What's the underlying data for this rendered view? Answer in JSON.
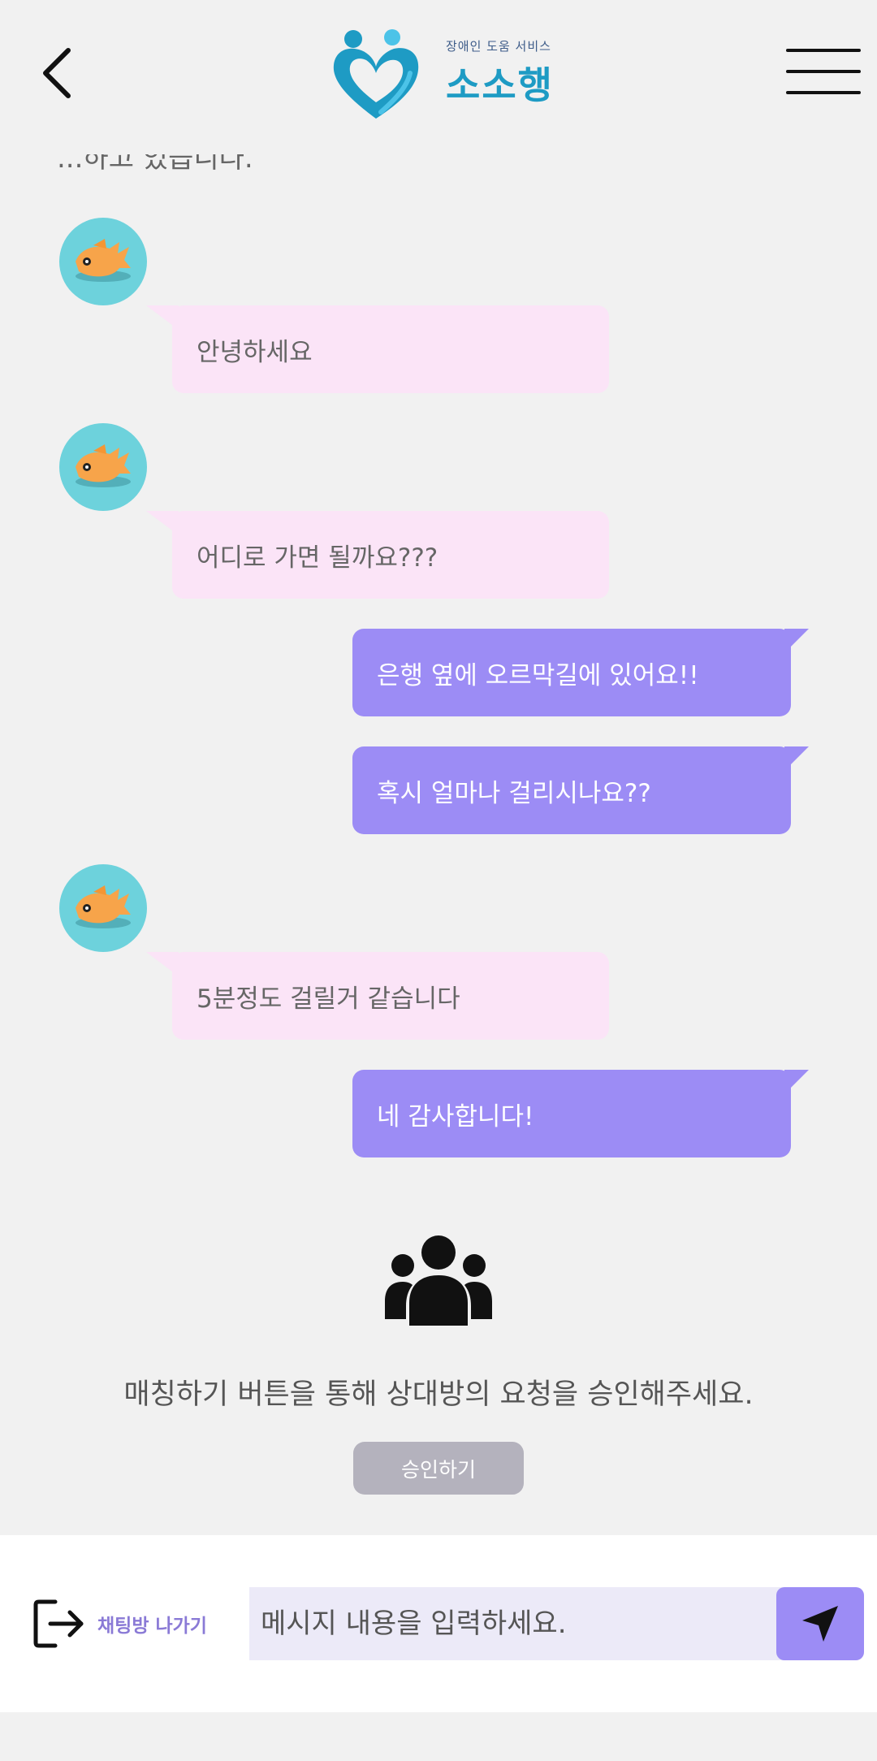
{
  "header": {
    "logo_sub": "장애인 도움 서비스",
    "logo_main": "소소행"
  },
  "chat": {
    "cut_text": "...하고 있습니다.",
    "messages": [
      {
        "side": "in",
        "text": "안녕하세요"
      },
      {
        "side": "in",
        "text": "어디로 가면 될까요???"
      },
      {
        "side": "out",
        "text": "은행 옆에 오르막길에 있어요!!"
      },
      {
        "side": "out",
        "text": "혹시 얼마나 걸리시나요??"
      },
      {
        "side": "in",
        "text": "5분정도 걸릴거 같습니다"
      },
      {
        "side": "out",
        "text": "네 감사합니다!"
      }
    ]
  },
  "matching": {
    "message": "매칭하기 버튼을 통해 상대방의 요청을 승인해주세요.",
    "approve_label": "승인하기"
  },
  "footer": {
    "exit_label": "채팅방 나가기",
    "input_placeholder": "메시지 내용을 입력하세요.",
    "input_value": ""
  },
  "colors": {
    "incoming_bubble": "#fbe4f7",
    "outgoing_bubble": "#9c8cf5",
    "avatar_bg": "#6dd2dc",
    "logo_blue": "#1e9bc4"
  },
  "icons": {
    "back": "chevron-left-icon",
    "menu": "hamburger-menu-icon",
    "avatar": "goldfish-avatar",
    "people": "group-people-icon",
    "exit": "exit-door-icon",
    "send": "send-arrow-icon"
  }
}
